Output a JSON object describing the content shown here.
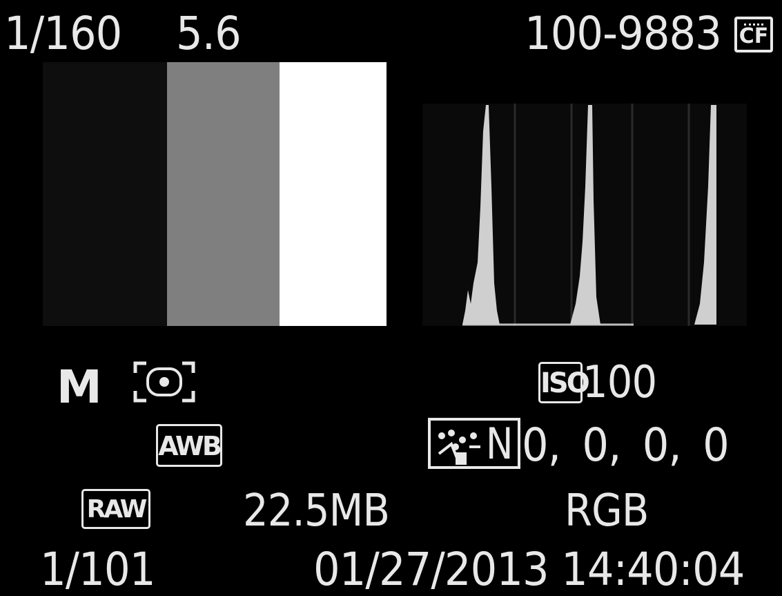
{
  "top_bar": {
    "shutter_speed": "1/160",
    "aperture": "5.6",
    "folder_file_number": "100-9883",
    "card_type": "CF"
  },
  "thumbnail": {
    "segments": [
      "black-icon",
      "gray-icon",
      "white-icon"
    ],
    "colors": {
      "black": "#0e0e0e",
      "gray": "#7f7f7f",
      "white": "#ffffff"
    }
  },
  "histogram": {
    "channel": "brightness",
    "peaks": [
      "shadow",
      "midtone",
      "highlight"
    ],
    "fill_color": "#cfcfcf"
  },
  "shooting_info": {
    "mode": "M",
    "metering_icon": "evaluative-metering-icon",
    "white_balance": "AWB",
    "iso_label": "ISO",
    "iso_value": "100",
    "picture_style_letter": "N",
    "picture_style_values": "0, 0, 0, 0",
    "image_quality": "RAW",
    "file_size": "22.5MB",
    "color_space": "RGB"
  },
  "footer": {
    "playback_number": "1/101",
    "date_time": "01/27/2013 14:40:04"
  }
}
